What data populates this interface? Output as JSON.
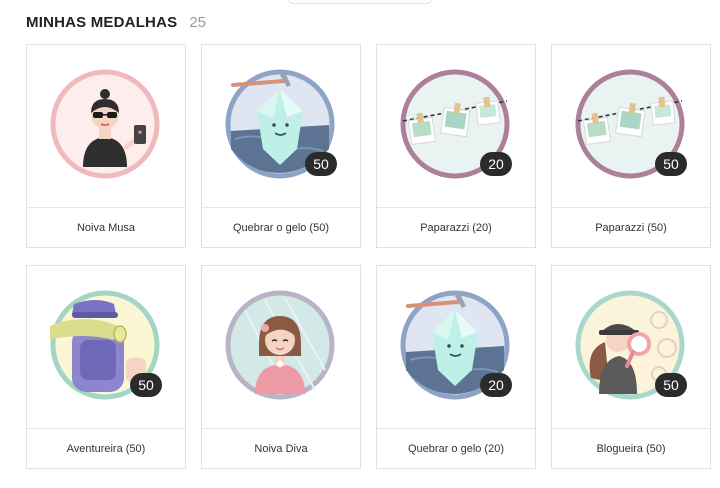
{
  "header": {
    "title": "MINHAS MEDALHAS",
    "count": "25"
  },
  "medals": [
    {
      "label": "Noiva Musa",
      "badge": "",
      "icon": "bride-muse-icon",
      "ring": "#f0b9bc",
      "fill": "#fdeeed"
    },
    {
      "label": "Quebrar o gelo (50)",
      "badge": "50",
      "icon": "ice-crystal-icon",
      "ring": "#8ea4c6",
      "fill": "#dfe6f1"
    },
    {
      "label": "Paparazzi (20)",
      "badge": "20",
      "icon": "photo-line-icon",
      "ring": "#ad7f98",
      "fill": "#e9f4f2"
    },
    {
      "label": "Paparazzi (50)",
      "badge": "50",
      "icon": "photo-line-icon",
      "ring": "#ad7f98",
      "fill": "#e9f4f2"
    },
    {
      "label": "Aventureira (50)",
      "badge": "50",
      "icon": "backpack-icon",
      "ring": "#a3d5c4",
      "fill": "#fbf6d4"
    },
    {
      "label": "Noiva Diva",
      "badge": "",
      "icon": "bride-diva-icon",
      "ring": "#b9b3c6",
      "fill": "#d2e9e8"
    },
    {
      "label": "Quebrar o gelo (20)",
      "badge": "20",
      "icon": "ice-crystal-icon",
      "ring": "#8ea4c6",
      "fill": "#dfe6f1"
    },
    {
      "label": "Blogueira (50)",
      "badge": "50",
      "icon": "blogger-detective-icon",
      "ring": "#a8d8cc",
      "fill": "#fbf3da"
    }
  ]
}
